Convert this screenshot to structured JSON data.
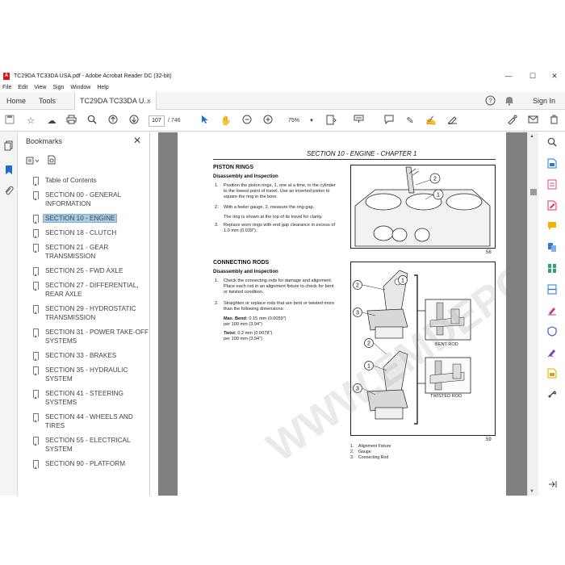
{
  "window": {
    "title": "TC29DA TC33DA USA.pdf - Adobe Acrobat Reader DC (32-bit)",
    "controls": [
      "—",
      "☐",
      "✕"
    ]
  },
  "menu": [
    "File",
    "Edit",
    "View",
    "Sign",
    "Window",
    "Help"
  ],
  "tabs": {
    "home": "Home",
    "tools": "Tools",
    "document": "TC29DA TC33DA U...",
    "document_close": "×",
    "sign_in": "Sign In"
  },
  "toolbar": {
    "current_page": "107",
    "page_count": "/ 746",
    "zoom": "75%"
  },
  "bookmarks": {
    "title": "Bookmarks",
    "items": [
      {
        "label": "Table of Contents",
        "selected": false
      },
      {
        "label": "SECTION 00 - GENERAL INFORMATION",
        "selected": false
      },
      {
        "label": "SECTION 10 - ENGINE",
        "selected": true
      },
      {
        "label": "SECTION 18 - CLUTCH",
        "selected": false
      },
      {
        "label": "SECTION 21 - GEAR TRANSMISSION",
        "selected": false
      },
      {
        "label": "SECTION 25 - FWD AXLE",
        "selected": false
      },
      {
        "label": "SECTION 27 - DIFFERENTIAL, REAR AXLE",
        "selected": false
      },
      {
        "label": "SECTION 29 - HYDROSTATIC TRANSMISSION",
        "selected": false
      },
      {
        "label": "SECTION 31 - POWER TAKE-OFF SYSTEMS",
        "selected": false
      },
      {
        "label": "SECTION 33 - BRAKES",
        "selected": false
      },
      {
        "label": "SECTION 35 - HYDRAULIC SYSTEM",
        "selected": false
      },
      {
        "label": "SECTION 41 - STEERING SYSTEMS",
        "selected": false
      },
      {
        "label": "SECTION 44 - WHEELS AND TIRES",
        "selected": false
      },
      {
        "label": "SECTION 55 - ELECTRICAL SYSTEM",
        "selected": false
      },
      {
        "label": "SECTION 90 - PLATFORM",
        "selected": false
      }
    ]
  },
  "page": {
    "header": "SECTION 10 - ENGINE - CHAPTER 1",
    "piston": {
      "heading": "PISTON RINGS",
      "subheading": "Disassembly and Inspection",
      "steps": [
        {
          "n": "1.",
          "text": "Position the piston rings, 1, one at a time, in the cylinder to the lowest point of travel. Use an inverted piston to square the ring in the bore."
        },
        {
          "n": "2.",
          "text": "With a feeler gauge, 2, measure the ring gap."
        },
        {
          "n": "",
          "text": "The ring is shown at the top of its travel for clarity."
        },
        {
          "n": "3.",
          "text": "Replace worn rings with end gap clearance in excess of 1.0 mm (0.039\")."
        }
      ],
      "figure_number": "58"
    },
    "rods": {
      "heading": "CONNECTING RODS",
      "subheading": "Disassembly and Inspection",
      "steps": [
        {
          "n": "1.",
          "text": "Check the connecting rods for damage and alignment. Place each rod in an alignment fixture to check for bent or twisted condition."
        },
        {
          "n": "2.",
          "text": "Straighten or replace rods that are bent or twisted more than the following dimensions:"
        }
      ],
      "max_bend_label": "Max. Bend:",
      "max_bend_value": "0.15 mm (0.0059\")",
      "max_bend_per": "per 100 mm (3.94\")",
      "twist_label": "Twist:",
      "twist_value": "0.2 mm (0.0078\")",
      "twist_per": "per 100 mm (3.94\")",
      "figure_number": "59",
      "bent_rod_label": "BENT ROD",
      "twisted_rod_label": "TWISTED ROD",
      "callouts": [
        {
          "n": "1.",
          "label": "Alignment Fixture"
        },
        {
          "n": "2.",
          "label": "Gauge"
        },
        {
          "n": "3.",
          "label": "Connecting Rod"
        }
      ]
    },
    "watermark": "WWW.EMDEPOT.COM"
  }
}
